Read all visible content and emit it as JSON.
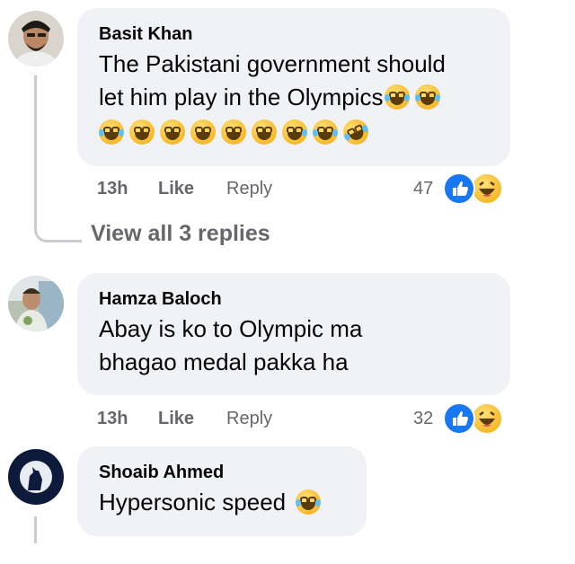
{
  "comments": [
    {
      "author": "Basit Khan",
      "text_line1": "The Pakistani government should",
      "text_line2": "let him play in the Olympics",
      "time": "13h",
      "like_label": "Like",
      "reply_label": "Reply",
      "reaction_count": "47",
      "reactions": [
        "like-icon",
        "haha-icon"
      ],
      "view_replies": "View all 3 replies"
    },
    {
      "author": "Hamza Baloch",
      "text_line1": "Abay is ko to Olympic ma",
      "text_line2": "bhagao medal pakka ha",
      "time": "13h",
      "like_label": "Like",
      "reply_label": "Reply",
      "reaction_count": "32",
      "reactions": [
        "like-icon",
        "haha-icon"
      ]
    },
    {
      "author": "Shoaib Ahmed",
      "text_line1": "Hypersonic speed"
    }
  ],
  "colors": {
    "bubble": "#f0f2f5",
    "meta": "#65676b",
    "like_blue": "#1877f2",
    "thread_line": "#c9ccd1"
  }
}
